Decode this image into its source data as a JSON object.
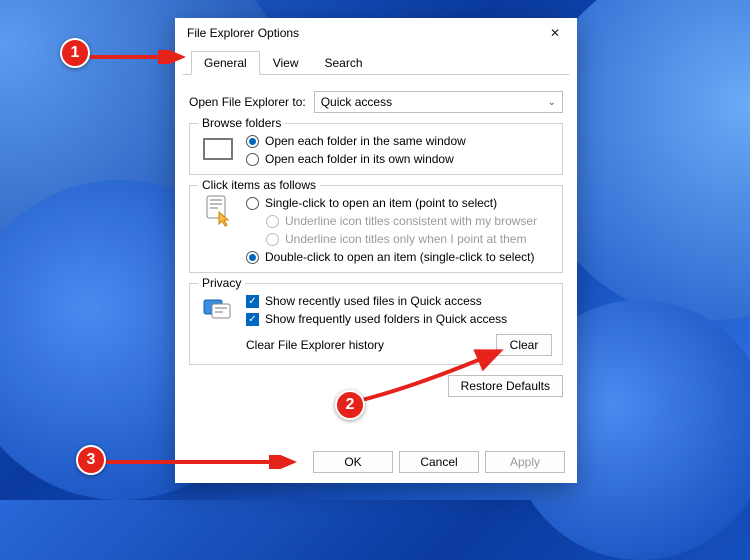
{
  "window": {
    "title": "File Explorer Options"
  },
  "tabs": {
    "general": "General",
    "view": "View",
    "search": "Search"
  },
  "open_to": {
    "label": "Open File Explorer to:",
    "value": "Quick access"
  },
  "browse": {
    "legend": "Browse folders",
    "same": "Open each folder in the same window",
    "own": "Open each folder in its own window"
  },
  "click": {
    "legend": "Click items as follows",
    "single": "Single-click to open an item (point to select)",
    "underline_browser": "Underline icon titles consistent with my browser",
    "underline_point": "Underline icon titles only when I point at them",
    "double": "Double-click to open an item (single-click to select)"
  },
  "privacy": {
    "legend": "Privacy",
    "recent_files": "Show recently used files in Quick access",
    "frequent_folders": "Show frequently used folders in Quick access",
    "clear_label": "Clear File Explorer history",
    "clear_btn": "Clear"
  },
  "restore": "Restore Defaults",
  "footer": {
    "ok": "OK",
    "cancel": "Cancel",
    "apply": "Apply"
  },
  "annotations": {
    "b1": "1",
    "b2": "2",
    "b3": "3"
  }
}
